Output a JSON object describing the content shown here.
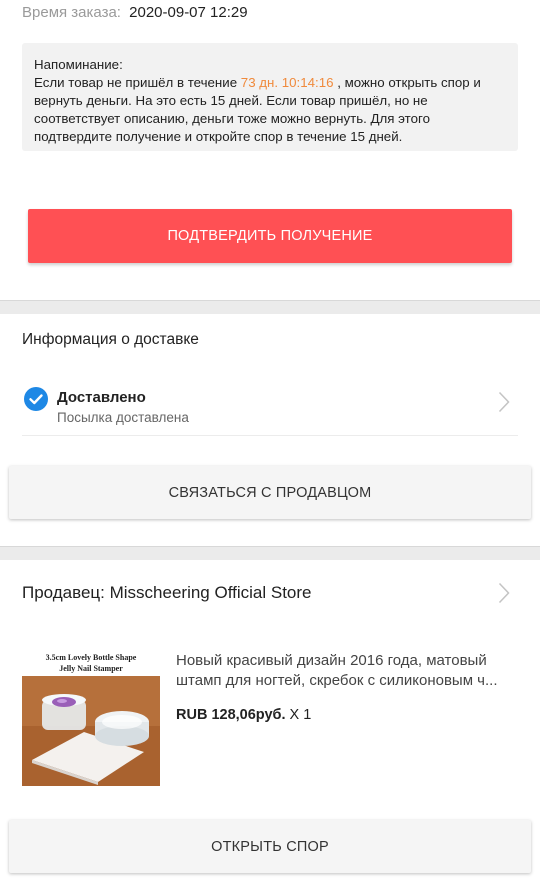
{
  "order": {
    "time_label": "Время заказа:",
    "time_value": "2020-09-07 12:29"
  },
  "reminder": {
    "title": "Напоминание:",
    "text_before": "Если товар не пришёл в течение ",
    "countdown": "73 дн. 10:14:16",
    "text_after": " , можно открыть спор и вернуть деньги. На это есть 15 дней.    Если товар пришёл, но не соответствует описанию, деньги тоже можно вернуть. Для этого подтвердите получение и откройте спор в течение 15 дней."
  },
  "buttons": {
    "confirm": "ПОДТВЕРДИТЬ ПОЛУЧЕНИЕ",
    "contact": "СВЯЗАТЬСЯ С ПРОДАВЦОМ",
    "dispute": "ОТКРЫТЬ СПОР"
  },
  "delivery": {
    "title": "Информация о доставке",
    "status": "Доставлено",
    "status_sub": "Посылка доставлена",
    "status_icon": "check-circle-icon"
  },
  "seller": {
    "label": "Продавец: Misscheering Official Store"
  },
  "product": {
    "image_caption_line1": "3.5cm Lovely Bottle Shape",
    "image_caption_line2": "Jelly Nail Stamper",
    "title_line1": "Новый красивый дизайн 2016 года, матовый",
    "title_line2": "штамп для ногтей, скребок с силиконовым ч...",
    "price": "RUB 128,06руб.",
    "quantity": "X 1"
  },
  "colors": {
    "accent_red": "#ff5054",
    "countdown_orange": "#f08a3c",
    "check_blue": "#1e88e5"
  }
}
